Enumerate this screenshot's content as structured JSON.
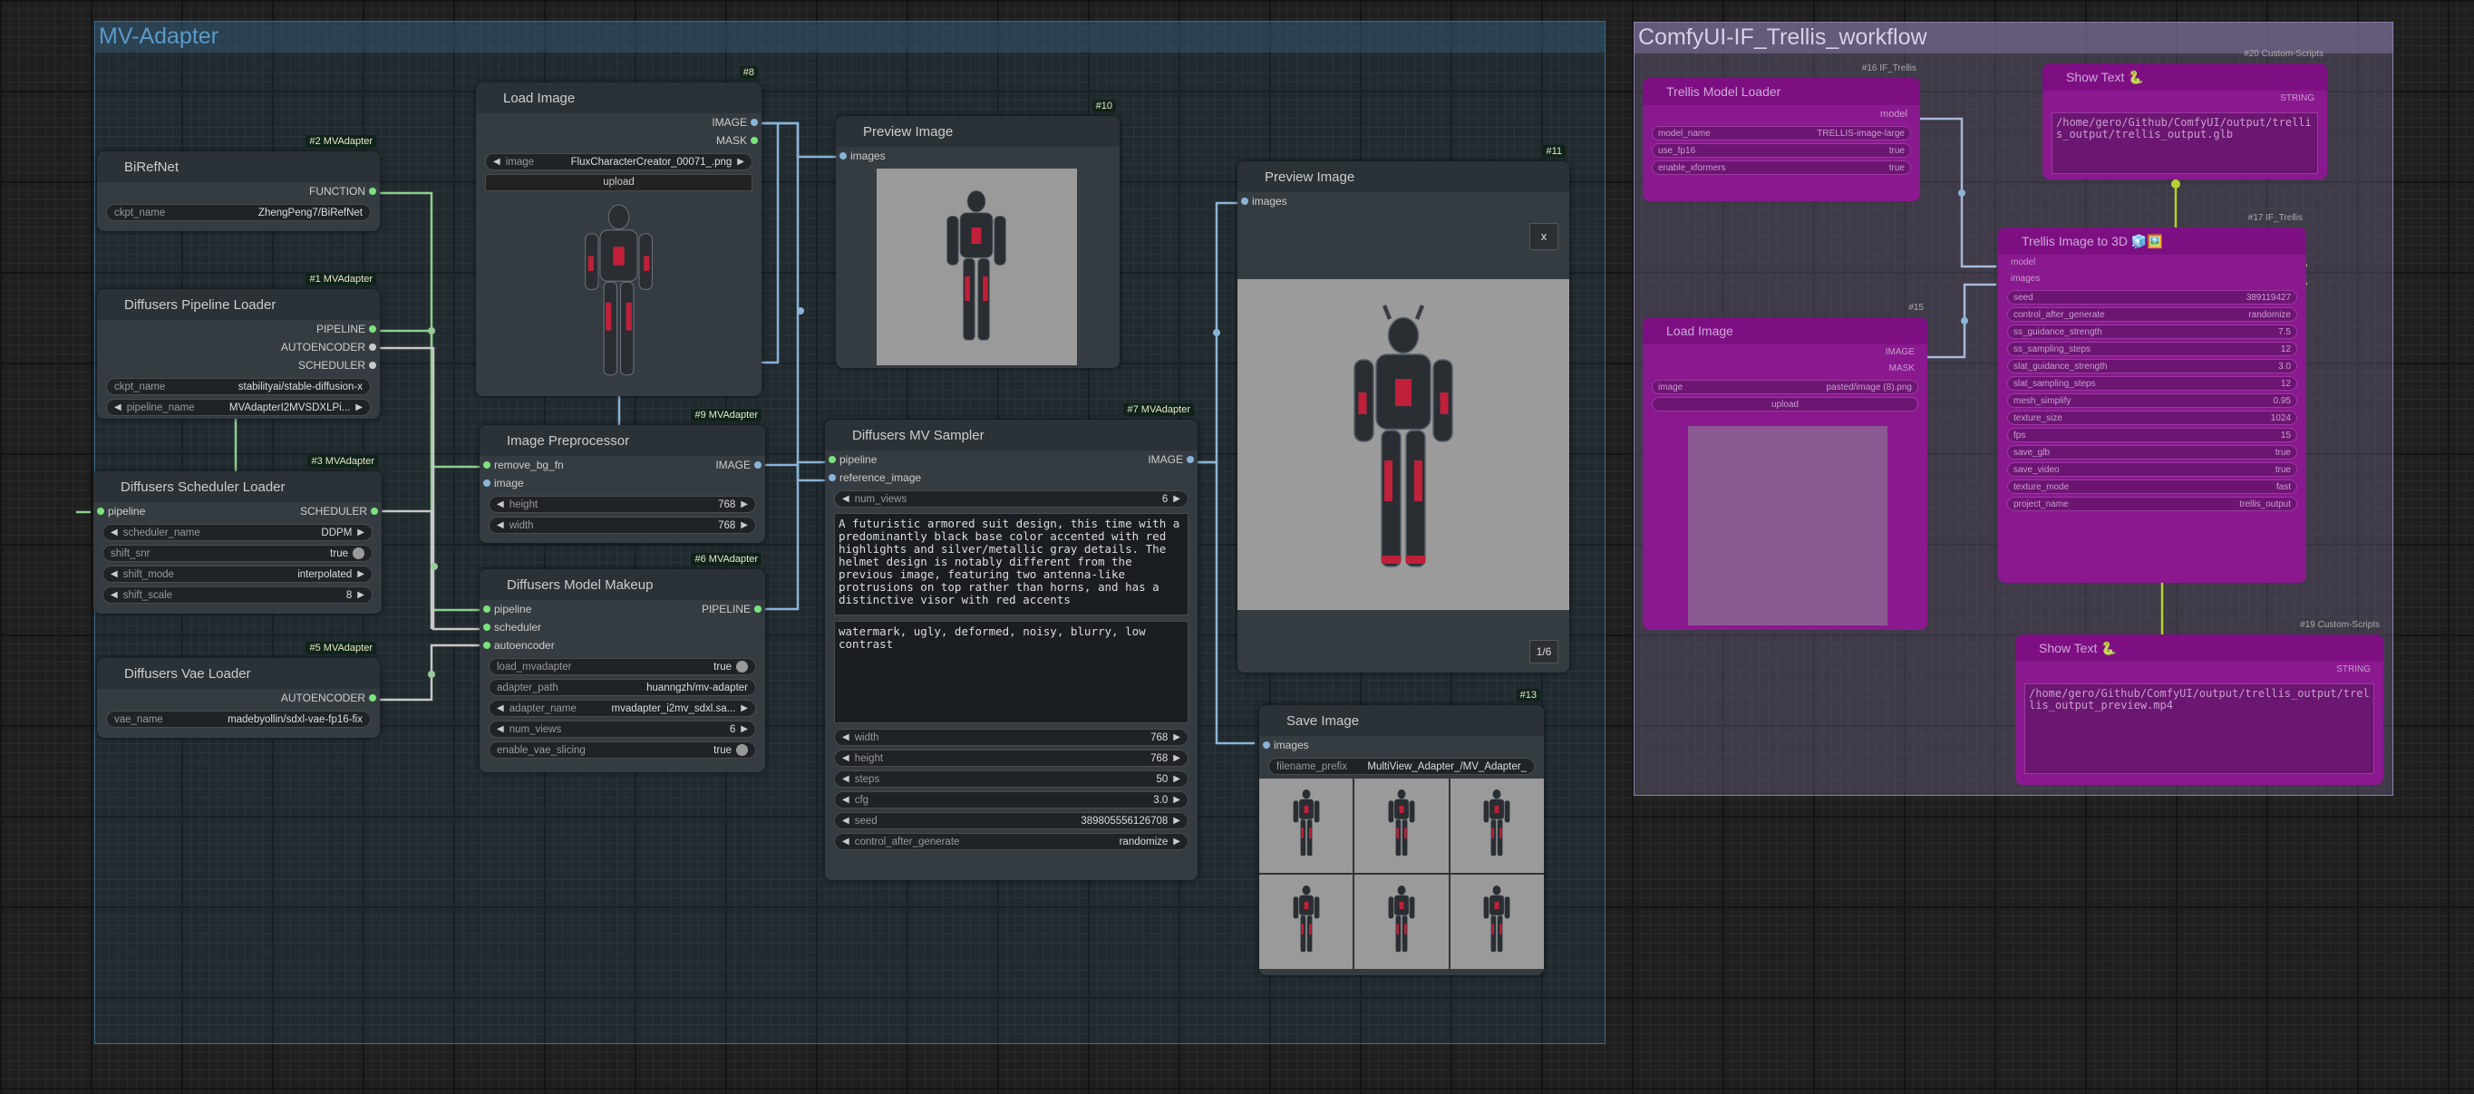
{
  "groups": {
    "mv_adapter": "MV-Adapter",
    "trellis": "ComfyUI-IF_Trellis_workflow"
  },
  "nodes": {
    "birefnet": {
      "title": "BiRefNet",
      "badge": "#2 MVAdapter",
      "out": "FUNCTION",
      "w_label": "ckpt_name",
      "w_val": "ZhengPeng7/BiRefNet"
    },
    "pipeline_loader": {
      "title": "Diffusers Pipeline Loader",
      "badge": "#1 MVAdapter",
      "outs": [
        "PIPELINE",
        "AUTOENCODER",
        "SCHEDULER"
      ],
      "ckpt_label": "ckpt_name",
      "ckpt_val": "stabilityai/stable-diffusion-x",
      "pipe_label": "pipeline_name",
      "pipe_val": "MVAdapterI2MVSDXLPi..."
    },
    "scheduler_loader": {
      "title": "Diffusers Scheduler Loader",
      "badge": "#3 MVAdapter",
      "in": "pipeline",
      "out": "SCHEDULER",
      "w": [
        {
          "l": "scheduler_name",
          "v": "DDPM"
        },
        {
          "l": "shift_snr",
          "v": "true"
        },
        {
          "l": "shift_mode",
          "v": "interpolated"
        },
        {
          "l": "shift_scale",
          "v": "8"
        }
      ]
    },
    "vae_loader": {
      "title": "Diffusers Vae Loader",
      "badge": "#5 MVAdapter",
      "out": "AUTOENCODER",
      "w_label": "vae_name",
      "w_val": "madebyollin/sdxl-vae-fp16-fix"
    },
    "load_image": {
      "title": "Load Image",
      "badge": "#8",
      "outs": [
        "IMAGE",
        "MASK"
      ],
      "w_label": "image",
      "w_val": "FluxCharacterCreator_00071_.png",
      "upload": "upload"
    },
    "image_preprocessor": {
      "title": "Image Preprocessor",
      "badge": "#9 MVAdapter",
      "ins": [
        "remove_bg_fn",
        "image"
      ],
      "out": "IMAGE",
      "w": [
        {
          "l": "height",
          "v": "768"
        },
        {
          "l": "width",
          "v": "768"
        }
      ]
    },
    "model_makeup": {
      "title": "Diffusers Model Makeup",
      "badge": "#6 MVAdapter",
      "ins": [
        "pipeline",
        "scheduler",
        "autoencoder"
      ],
      "out": "PIPELINE",
      "w": [
        {
          "l": "load_mvadapter",
          "v": "true"
        },
        {
          "l": "adapter_path",
          "v": "huanngzh/mv-adapter"
        },
        {
          "l": "adapter_name",
          "v": "mvadapter_i2mv_sdxl.sa..."
        },
        {
          "l": "num_views",
          "v": "6"
        },
        {
          "l": "enable_vae_slicing",
          "v": "true"
        }
      ]
    },
    "preview10": {
      "title": "Preview Image",
      "badge": "#10",
      "in": "images"
    },
    "mv_sampler": {
      "title": "Diffusers MV Sampler",
      "badge": "#7 MVAdapter",
      "ins": [
        "pipeline",
        "reference_image"
      ],
      "out": "IMAGE",
      "num_views_label": "num_views",
      "num_views": "6",
      "prompt": "A futuristic armored suit design, this time with a predominantly black base color accented with red highlights and silver/metallic gray details. The helmet design is notably different from the previous image, featuring two antenna-like protrusions on top rather than horns, and has a distinctive visor with red accents",
      "negative": "watermark, ugly, deformed, noisy, blurry, low contrast",
      "w": [
        {
          "l": "width",
          "v": "768"
        },
        {
          "l": "height",
          "v": "768"
        },
        {
          "l": "steps",
          "v": "50"
        },
        {
          "l": "cfg",
          "v": "3.0"
        },
        {
          "l": "seed",
          "v": "389805556126708"
        },
        {
          "l": "control_after_generate",
          "v": "randomize"
        }
      ]
    },
    "preview11": {
      "title": "Preview Image",
      "badge": "#11",
      "in": "images",
      "close": "x",
      "counter": "1/6"
    },
    "save_image": {
      "title": "Save Image",
      "badge": "#13",
      "in": "images",
      "w_label": "filename_prefix",
      "w_val": "MultiView_Adapter_/MV_Adapter_"
    },
    "trellis_loader": {
      "title": "Trellis Model Loader",
      "badge": "#16 IF_Trellis",
      "out": "model",
      "w": [
        {
          "l": "model_name",
          "v": "TRELLIS-image-large"
        },
        {
          "l": "use_fp16",
          "v": "true"
        },
        {
          "l": "enable_xformers",
          "v": "true"
        }
      ]
    },
    "load_image15": {
      "title": "Load Image",
      "badge": "#15",
      "outs": [
        "IMAGE",
        "MASK"
      ],
      "w_label": "image",
      "w_val": "pasted/image (8).png",
      "upload": "upload"
    },
    "show_text20": {
      "title": "Show Text",
      "badge": "#20 Custom-Scripts",
      "out": "STRING",
      "text": "/home/gero/Github/ComfyUI/output/trellis_output/trellis_output.glb"
    },
    "trellis_image": {
      "title": "Trellis Image to 3D",
      "badge": "#17 IF_Trellis",
      "ins": [
        "model",
        "images"
      ],
      "w": [
        {
          "l": "seed",
          "v": "389119427"
        },
        {
          "l": "control_after_generate",
          "v": "randomize"
        },
        {
          "l": "ss_guidance_strength",
          "v": "7.5"
        },
        {
          "l": "ss_sampling_steps",
          "v": "12"
        },
        {
          "l": "slat_guidance_strength",
          "v": "3.0"
        },
        {
          "l": "slat_sampling_steps",
          "v": "12"
        },
        {
          "l": "mesh_simplify",
          "v": "0.95"
        },
        {
          "l": "texture_size",
          "v": "1024"
        },
        {
          "l": "fps",
          "v": "15"
        },
        {
          "l": "save_glb",
          "v": "true"
        },
        {
          "l": "save_video",
          "v": "true"
        },
        {
          "l": "texture_mode",
          "v": "fast"
        },
        {
          "l": "project_name",
          "v": "trellis_output"
        }
      ]
    },
    "show_text19": {
      "title": "Show Text",
      "badge": "#19 Custom-Scripts",
      "out": "STRING",
      "text": "/home/gero/Github/ComfyUI/output/trellis_output/trellis_output_preview.mp4"
    }
  },
  "colors": {
    "accent_green": "#7ce27c",
    "link_blue": "#8ab4d8",
    "link_gray": "#c8c8c8",
    "trellis_purple": "#8a198f",
    "trellis_link": "#b8d030"
  },
  "icons": {
    "show_text": "snake-icon",
    "trellis_image": "emoji-icons"
  }
}
